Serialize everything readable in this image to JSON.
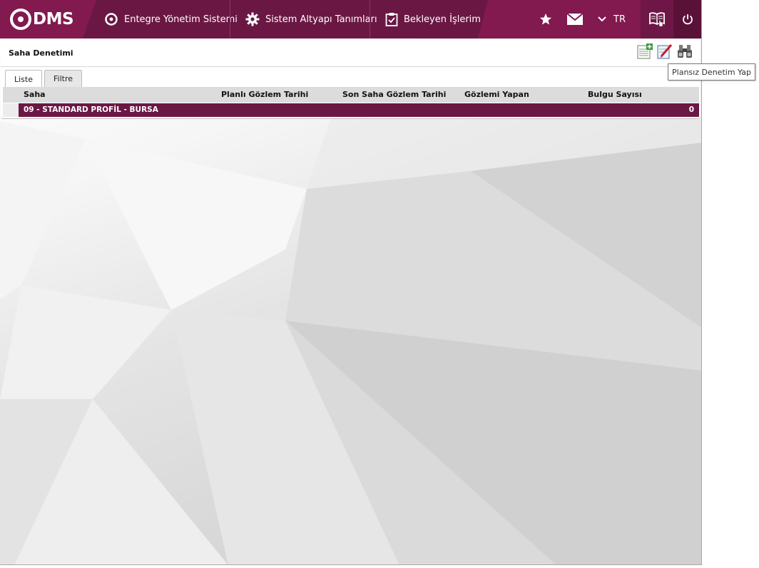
{
  "app": {
    "logo_text": "DMS",
    "menu": [
      {
        "label": "Entegre Yönetim Sistemi",
        "icon": "qdms-circle-icon"
      },
      {
        "label": "Sistem Altyapı Tanımları",
        "icon": "gear-icon"
      },
      {
        "label": "Bekleyen İşlerim",
        "icon": "clipboard-icon"
      }
    ],
    "toolbar_icons": [
      "star-icon",
      "mail-icon",
      "chevron-down-icon",
      "book-icon",
      "power-icon"
    ],
    "language": "TR",
    "colors": {
      "primary": "#6b1744",
      "accent": "#82194f"
    }
  },
  "panel": {
    "title": "Saha Denetimi",
    "tools": [
      "add-list-icon",
      "edit-report-icon",
      "binoculars-icon"
    ],
    "tabs": [
      {
        "label": "Liste",
        "active": true
      },
      {
        "label": "Filtre",
        "active": false
      }
    ],
    "columns": [
      "Saha",
      "Planlı Gözlem Tarihi",
      "Son Saha Gözlem Tarihi",
      "Gözlemi Yapan",
      "Bulgu Sayısı"
    ],
    "rows": [
      {
        "saha": "09 - STANDARD PROFİL - BURSA",
        "planli": "",
        "son": "",
        "yapan": "",
        "bulgu": "0"
      }
    ]
  },
  "tooltip": {
    "text": "Plansız Denetim Yap"
  }
}
